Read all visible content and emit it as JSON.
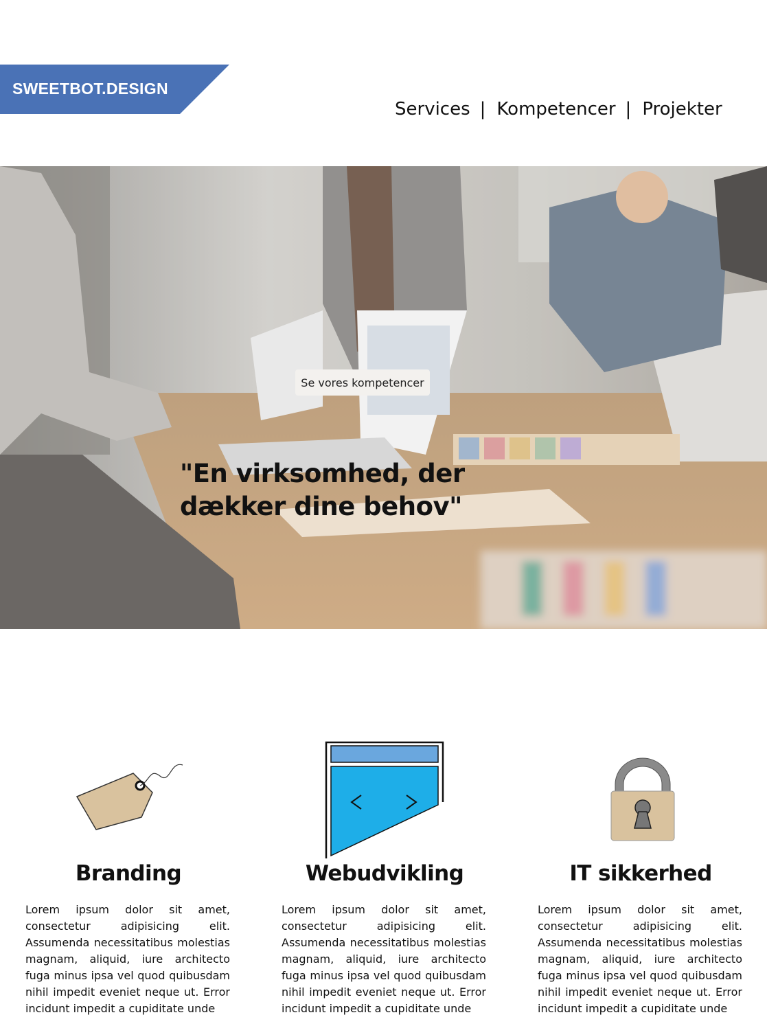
{
  "header": {
    "logo_text": "SWEETBOT.DESIGN",
    "brand_color": "#4a72b6",
    "nav": [
      {
        "label": "Services"
      },
      {
        "label": "Kompetencer"
      },
      {
        "label": "Projekter"
      }
    ],
    "separator": "|"
  },
  "hero": {
    "title_line1": "\"En virksomhed, der",
    "title_line2": "dækker dine behov\"",
    "button_label": "Se vores kompetencer"
  },
  "services": [
    {
      "title": "Branding",
      "icon": "price-tag-icon",
      "text": "Lorem ipsum dolor sit amet, consectetur adipisicing elit. Assumenda necessitatibus molestias magnam, aliquid, iure architecto fuga minus ipsa vel quod quibusdam nihil impedit eveniet neque ut. Error incidunt impedit a cupiditate unde"
    },
    {
      "title": "Webudvikling",
      "icon": "web-browser-icon",
      "text": "Lorem ipsum dolor sit amet, consectetur adipisicing elit. Assumenda necessitatibus molestias magnam, aliquid, iure architecto fuga minus ipsa vel quod quibusdam nihil impedit eveniet neque ut. Error incidunt impedit a cupiditate unde"
    },
    {
      "title": "IT sikkerhed",
      "icon": "padlock-icon",
      "text": "Lorem ipsum dolor sit amet, consectetur adipisicing elit. Assumenda necessitatibus molestias magnam, aliquid, iure architecto fuga minus ipsa vel quod quibusdam nihil impedit eveniet neque ut. Error incidunt impedit a cupiditate unde"
    }
  ]
}
